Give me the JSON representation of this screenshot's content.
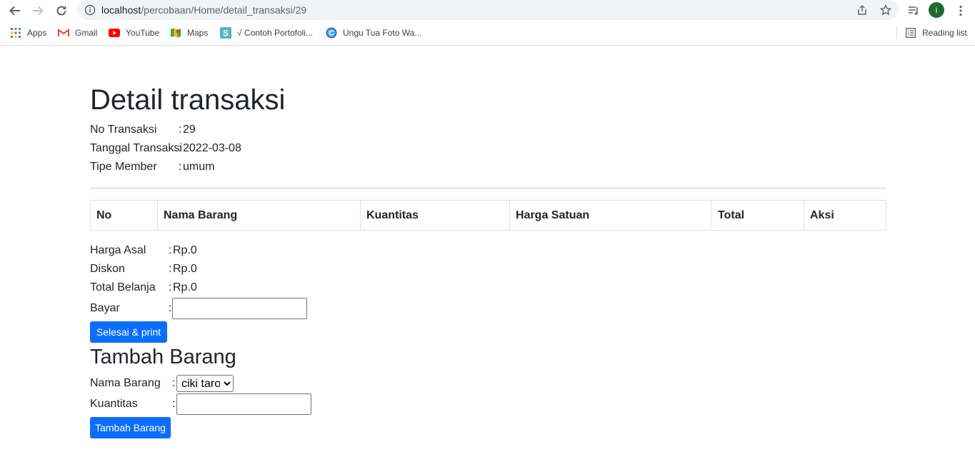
{
  "browser": {
    "url_host": "localhost",
    "url_path": "/percobaan/Home/detail_transaksi/29",
    "profile_initial": "i",
    "bookmarks": [
      {
        "label": "Apps",
        "icon": "apps-grid-icon"
      },
      {
        "label": "Gmail",
        "icon": "gmail-icon"
      },
      {
        "label": "YouTube",
        "icon": "youtube-icon"
      },
      {
        "label": "Maps",
        "icon": "maps-icon"
      },
      {
        "label": "√ Contoh Portofoli...",
        "icon": "s-bookmark-icon"
      },
      {
        "label": "Ungu Tua Foto Wa...",
        "icon": "canva-icon"
      }
    ],
    "reading_list": "Reading list",
    "colors": {
      "accent": "#0d6efd",
      "avatar": "#1e6b2e",
      "omnibox": "#f1f3f4"
    }
  },
  "page": {
    "title": "Detail transaksi",
    "info": [
      {
        "label": "No Transaksi",
        "value": "29"
      },
      {
        "label": "Tanggal Transaksi",
        "value": "2022-03-08"
      },
      {
        "label": "Tipe Member",
        "value": "umum"
      }
    ],
    "separator": ":",
    "table": {
      "headers": [
        "No",
        "Nama Barang",
        "Kuantitas",
        "Harga Satuan",
        "Total",
        "Aksi"
      ],
      "rows": []
    },
    "summary": [
      {
        "label": "Harga Asal",
        "value": "Rp.0"
      },
      {
        "label": "Diskon",
        "value": "Rp.0"
      },
      {
        "label": "Total Belanja",
        "value": "Rp.0"
      }
    ],
    "bayar": {
      "label": "Bayar",
      "value": ""
    },
    "finish_button": "Selesai & print",
    "add_section": {
      "title": "Tambah Barang",
      "item_label": "Nama Barang",
      "item_selected": "ciki taro",
      "qty_label": "Kuantitas",
      "qty_value": "",
      "add_button": "Tambah Barang"
    }
  }
}
